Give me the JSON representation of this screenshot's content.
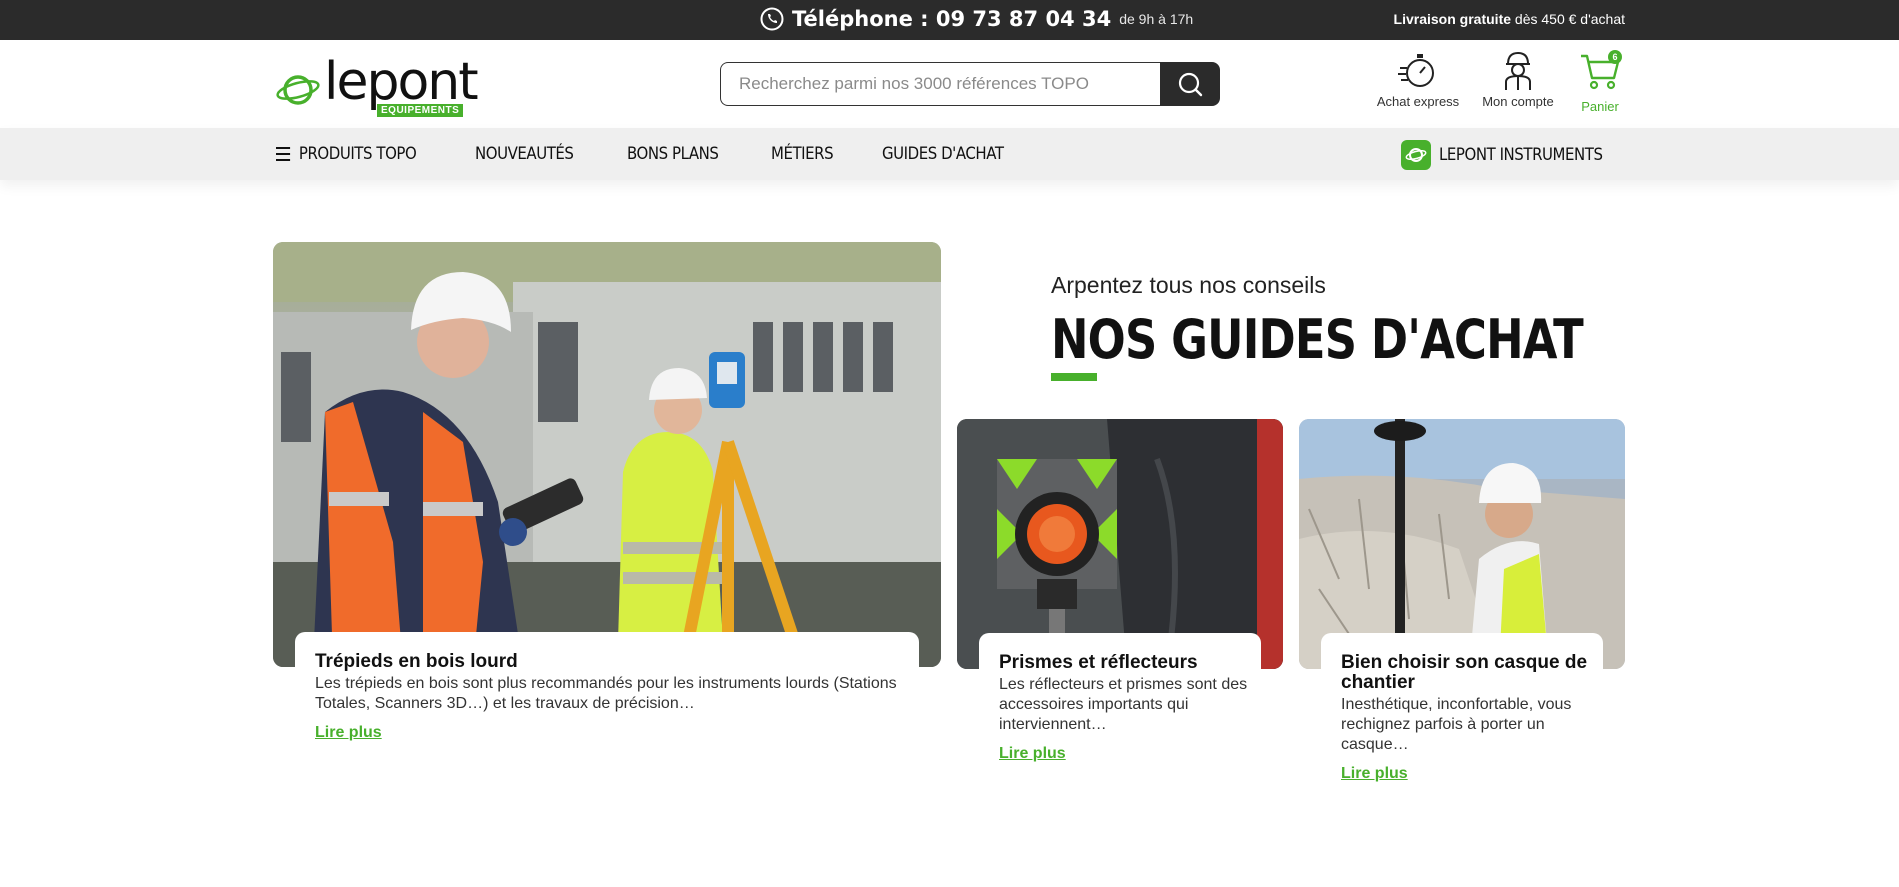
{
  "topbar": {
    "phone_label": "Téléphone : 09 73 87 04 34",
    "phone_hours": "de 9h à 17h",
    "shipping_bold": "Livraison gratuite",
    "shipping_rest": "dès 450 € d'achat"
  },
  "header": {
    "logo_wordmark": "lepont",
    "logo_sub": "EQUIPEMENTS",
    "search_placeholder": "Recherchez parmi nos 3000 références TOPO",
    "express_label": "Achat express",
    "account_label": "Mon compte",
    "cart_label": "Panier",
    "cart_count": "6"
  },
  "nav": {
    "items": [
      {
        "label": "PRODUITS TOPO"
      },
      {
        "label": "NOUVEAUTÉS"
      },
      {
        "label": "BONS PLANS"
      },
      {
        "label": "MÉTIERS"
      },
      {
        "label": "GUIDES D'ACHAT"
      }
    ],
    "instruments_label": "LEPONT INSTRUMENTS"
  },
  "guides": {
    "subtitle": "Arpentez tous nos conseils",
    "title": "NOS GUIDES D'ACHAT",
    "cards": [
      {
        "title": "Trépieds en bois lourd",
        "desc": "Les trépieds en bois sont plus recommandés pour les instruments lourds (Stations Totales, Scanners 3D…) et les travaux de précision…",
        "more": "Lire plus"
      },
      {
        "title": "Prismes et réflecteurs",
        "desc": "Les réflecteurs et prismes sont des accessoires importants qui interviennent…",
        "more": "Lire plus"
      },
      {
        "title": "Bien choisir son casque de chantier",
        "desc": "Inesthétique, inconfortable, vous rechignez parfois à porter un casque…",
        "more": "Lire plus"
      }
    ]
  },
  "colors": {
    "brand_green": "#48b02c",
    "topbar_bg": "#2b2b2b",
    "nav_bg": "#efefef"
  }
}
